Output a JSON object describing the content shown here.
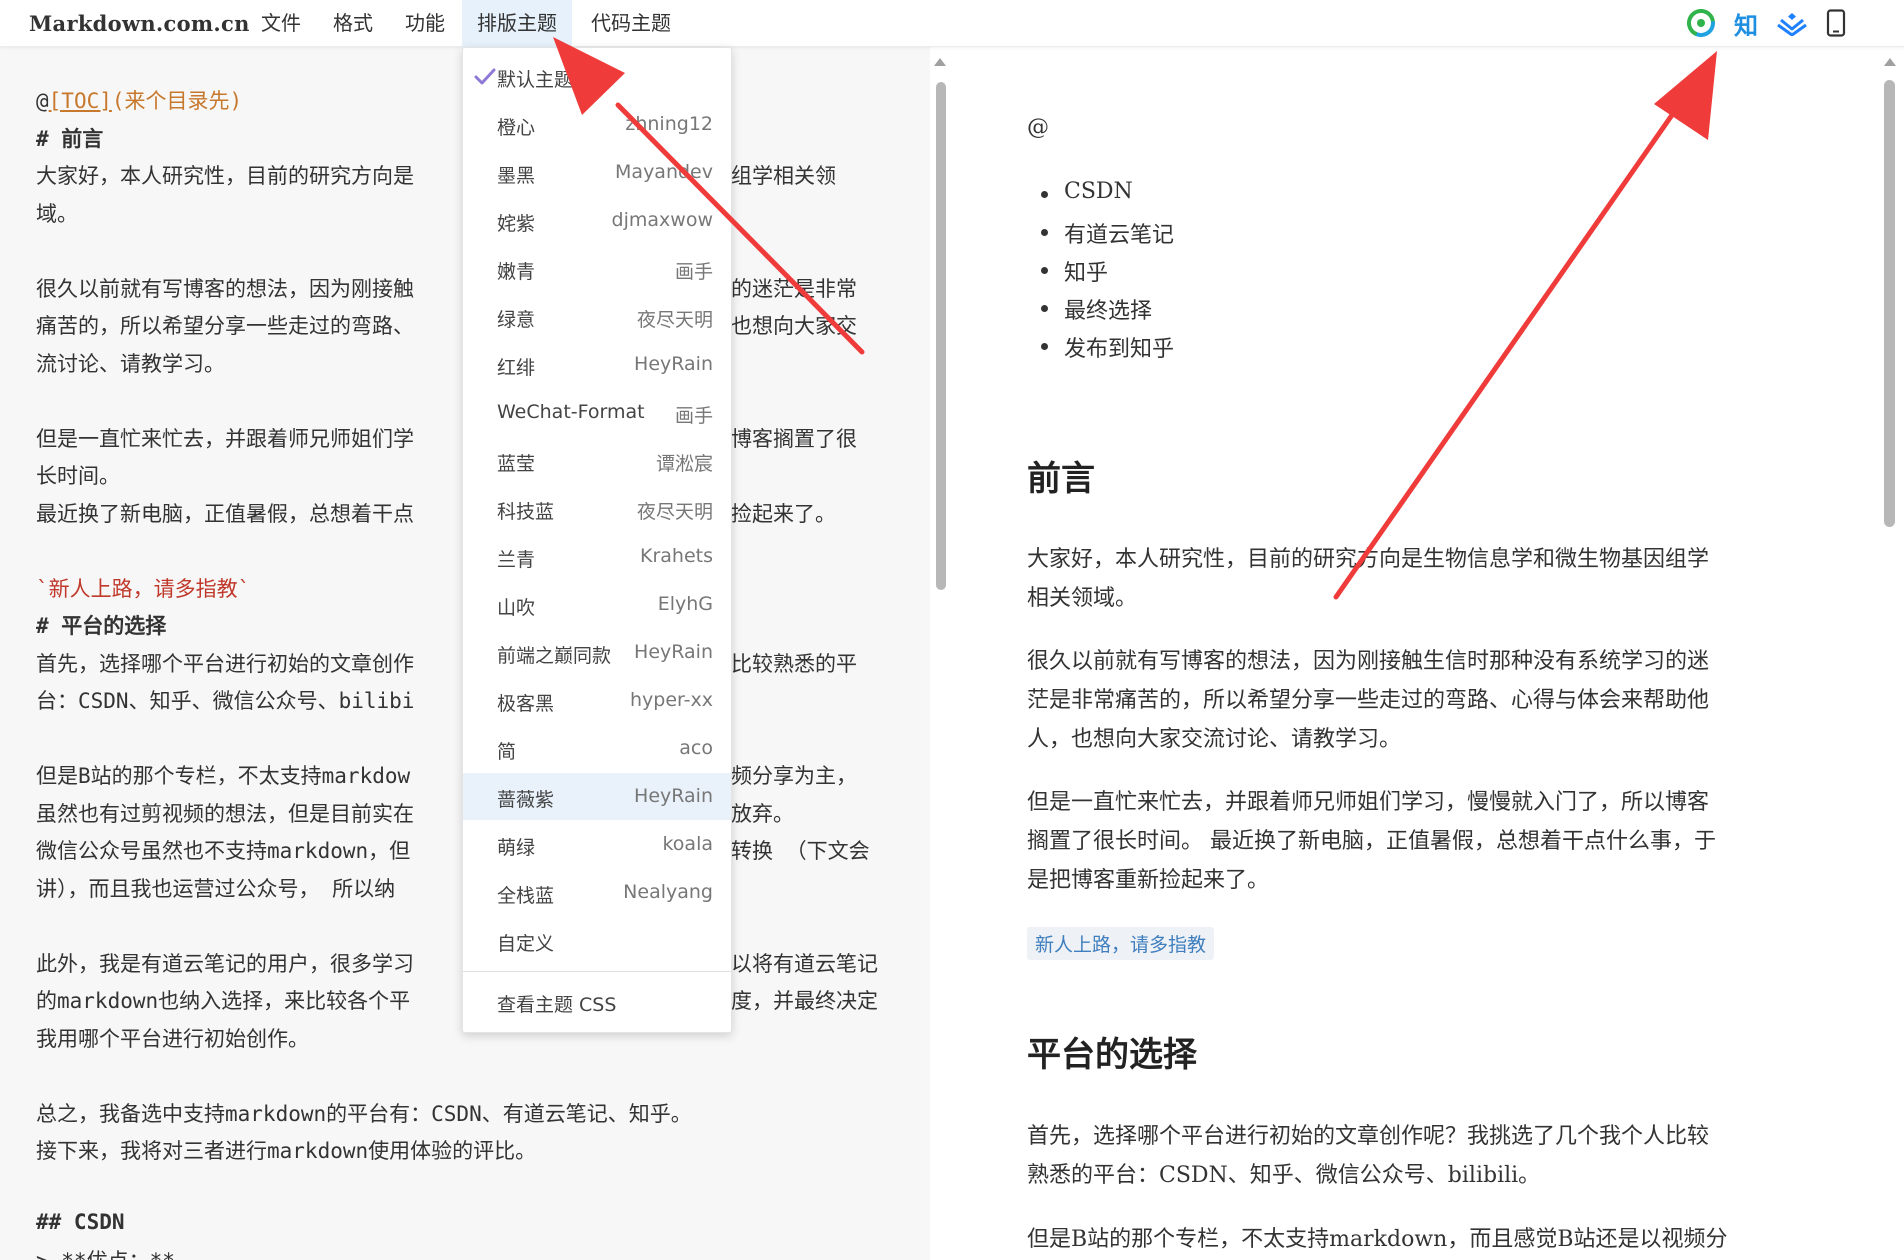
{
  "app": {
    "brand": "Markdown.com.cn"
  },
  "menu": {
    "file": "文件",
    "format": "格式",
    "feature": "功能",
    "layout_theme": "排版主题",
    "code_theme": "代码主题"
  },
  "toolbar": {
    "zhihu_label": "知",
    "icons": [
      "wechat-icon",
      "zhihu-icon",
      "juejin-icon",
      "mobile-preview-icon"
    ]
  },
  "theme_menu": {
    "items": [
      {
        "name": "默认主题",
        "author": "",
        "checked": true
      },
      {
        "name": "橙心",
        "author": "zhning12"
      },
      {
        "name": "墨黑",
        "author": "Mayandev"
      },
      {
        "name": "姹紫",
        "author": "djmaxwow"
      },
      {
        "name": "嫩青",
        "author": "画手"
      },
      {
        "name": "绿意",
        "author": "夜尽天明"
      },
      {
        "name": "红绯",
        "author": "HeyRain"
      },
      {
        "name": "WeChat-Format",
        "author": "画手"
      },
      {
        "name": "蓝莹",
        "author": "谭淞宸"
      },
      {
        "name": "科技蓝",
        "author": "夜尽天明"
      },
      {
        "name": "兰青",
        "author": "Krahets"
      },
      {
        "name": "山吹",
        "author": "ElyhG"
      },
      {
        "name": "前端之巅同款",
        "author": "HeyRain"
      },
      {
        "name": "极客黑",
        "author": "hyper-xx"
      },
      {
        "name": "简",
        "author": "aco"
      },
      {
        "name": "蔷薇紫",
        "author": "HeyRain",
        "highlighted": true
      },
      {
        "name": "萌绿",
        "author": "koala"
      },
      {
        "name": "全栈蓝",
        "author": "Nealyang"
      },
      {
        "name": "自定义",
        "author": ""
      }
    ],
    "view_css": "查看主题 CSS"
  },
  "editor": {
    "line1_at": "@",
    "line1_toc": "[TOC]",
    "line1_rest": "(来个目录先)",
    "h_preface": "#  前言",
    "p1a": "大家好，本人研究性，目前的研究方向是",
    "p1a_tail": "组学相关领",
    "p1b": "域。",
    "p2a": "很久以前就有写博客的想法，因为刚接触",
    "p2a_tail": "的迷茫是非常",
    "p2b": "痛苦的，所以希望分享一些走过的弯路、",
    "p2b_tail": "也想向大家交",
    "p2c": "流讨论、请教学习。",
    "p3a": "但是一直忙来忙去，并跟着师兄师姐们学",
    "p3a_tail": "博客搁置了很",
    "p3b": "长时间。",
    "p3c": "最近换了新电脑，正值暑假，总想着干点",
    "p3c_tail": "捡起来了。",
    "code_line": "`新人上路，请多指教`",
    "h_platform": "#   平台的选择",
    "p4a": "首先，选择哪个平台进行初始的文章创作",
    "p4a_tail": "比较熟悉的平",
    "p4b": "台：CSDN、知乎、微信公众号、bilibi",
    "p5a": "但是B站的那个专栏，不太支持markdow",
    "p5a_tail": "频分享为主，",
    "p5b": "虽然也有过剪视频的想法，但是目前实在",
    "p5b_tail": "放弃。",
    "p5c": "微信公众号虽然也不支持markdown，但",
    "p5c_tail": "转换 （下文会",
    "p5d": "讲），而且我也运营过公众号，  所以纳",
    "p6a": "此外，我是有道云笔记的用户，很多学习",
    "p6a_tail": "以将有道云笔记",
    "p6b": "的markdown也纳入选择，来比较各个平",
    "p6b_tail": "度，并最终决定",
    "p6c": "我用哪个平台进行初始创作。",
    "p7a": "总之，我备选中支持markdown的平台有：CSDN、有道云笔记、知乎。",
    "p7b": "接下来，我将对三者进行markdown使用体验的评比。",
    "h_csdn": "## CSDN",
    "last_line": "> **优点：**"
  },
  "preview": {
    "at": "@",
    "toc": [
      "CSDN",
      "有道云笔记",
      "知乎",
      "最终选择",
      "发布到知乎"
    ],
    "h_preface": "前言",
    "p1": [
      "大家好，本人研究性，目前的研究方向是生物信息学和微生物基因组学",
      "相关领域。"
    ],
    "p2": [
      "很久以前就有写博客的想法，因为刚接触生信时那种没有系统学习的迷",
      "茫是非常痛苦的，所以希望分享一些走过的弯路、心得与体会来帮助他",
      "人，也想向大家交流讨论、请教学习。"
    ],
    "p3": [
      "但是一直忙来忙去，并跟着师兄师姐们学习，慢慢就入门了，所以博客",
      "搁置了很长时间。 最近换了新电脑，正值暑假，总想着干点什么事，于",
      "是把博客重新捡起来了。"
    ],
    "code": "新人上路，请多指教",
    "h_platform": "平台的选择",
    "p4": [
      "首先，选择哪个平台进行初始的文章创作呢？我挑选了几个我个人比较",
      "熟悉的平台：CSDN、知乎、微信公众号、bilibili。"
    ],
    "p5": [
      "但是B站的那个专栏，不太支持markdown，而且感觉B站还是以视频分"
    ]
  },
  "colors": {
    "arrow": "#f03b3b",
    "menu_active_bg": "#e6f1fb",
    "toc_link": "#c7782c",
    "inline_code": "#c0392b",
    "preview_code": "#3f7fbf",
    "check": "#8e7ad6"
  }
}
